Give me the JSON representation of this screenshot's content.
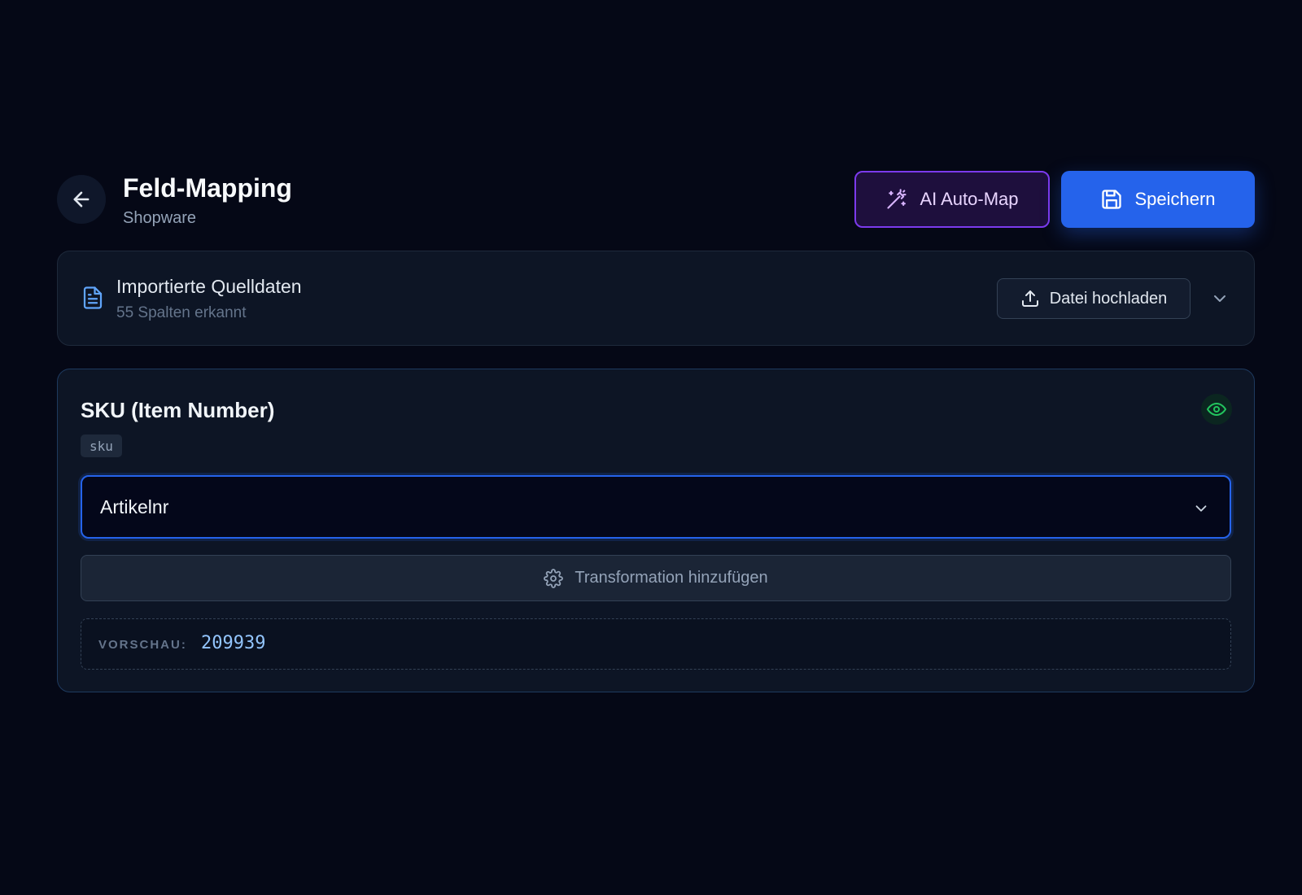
{
  "header": {
    "title": "Feld-Mapping",
    "subtitle": "Shopware",
    "back_icon": "arrow-left-icon",
    "ai_button_label": "AI Auto-Map",
    "ai_button_icon": "magic-wand-icon",
    "save_button_label": "Speichern",
    "save_button_icon": "floppy-disk-icon"
  },
  "source": {
    "title": "Importierte Quelldaten",
    "subtitle": "55 Spalten erkannt",
    "icon": "file-text-icon",
    "upload_label": "Datei hochladen",
    "upload_icon": "upload-icon",
    "collapse_icon": "chevron-down-icon"
  },
  "field": {
    "title": "SKU (Item Number)",
    "key": "sku",
    "visibility_icon": "eye-icon",
    "selected_column": "Artikelnr",
    "transform_label": "Transformation hinzufügen",
    "transform_icon": "gear-icon",
    "preview_label": "VORSCHAU:",
    "preview_value": "209939"
  },
  "colors": {
    "background": "#050816",
    "card": "#0d1525",
    "primary": "#2563eb",
    "ai_accent": "#7c3aed",
    "success": "#22c55e",
    "preview_text": "#93c5fd"
  }
}
